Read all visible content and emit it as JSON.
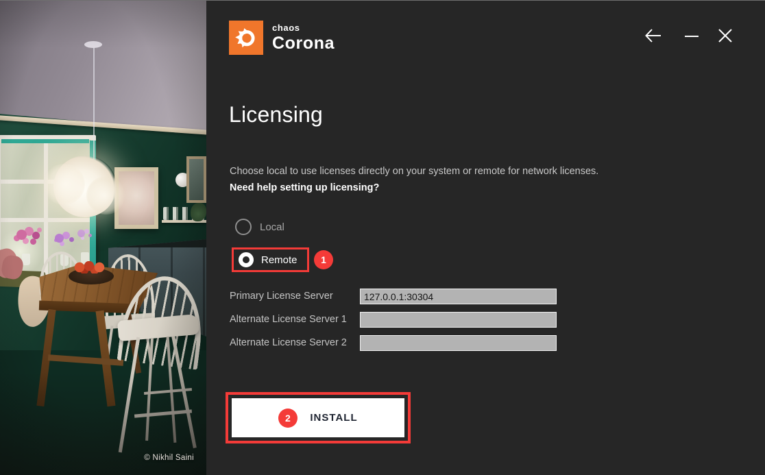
{
  "colors": {
    "panel_bg": "#262626",
    "annotation_red": "#f43b38",
    "accent_orange": "#f0762b",
    "input_bg": "#b3b3b3"
  },
  "brand": {
    "chaos": "chaos",
    "corona": "Corona",
    "logo_icon": "corona-flame-icon"
  },
  "titlebar": {
    "icons": [
      "back-arrow-icon",
      "minimize-icon",
      "close-icon"
    ]
  },
  "licensing": {
    "title": "Licensing",
    "description": "Choose local to use licenses directly on your system or remote for network licenses.",
    "help_link": "Need help setting up licensing?",
    "options": [
      {
        "label": "Local",
        "selected": false
      },
      {
        "label": "Remote",
        "selected": true
      }
    ],
    "fields": [
      {
        "label": "Primary License Server",
        "value": "127.0.0.1:30304"
      },
      {
        "label": "Alternate License Server 1",
        "value": ""
      },
      {
        "label": "Alternate License Server 2",
        "value": ""
      }
    ],
    "install_button": "INSTALL",
    "annotations": {
      "step1": "1",
      "step2": "2"
    }
  },
  "photo": {
    "credit": "© Nikhil Saini"
  }
}
